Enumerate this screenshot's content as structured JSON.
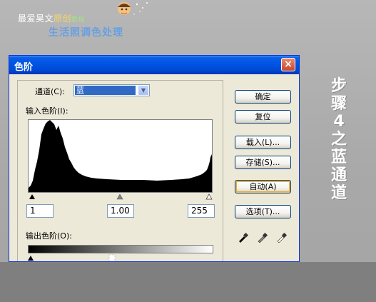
{
  "banner": {
    "title_prefix": "最爱昊文",
    "title_hl1": "原创",
    "title_suffix": "教程",
    "subtitle": "生活照调色处理"
  },
  "side_caption": [
    "步",
    "骤",
    "4",
    "之",
    "蓝",
    "通",
    "道"
  ],
  "dialog": {
    "title": "色阶",
    "close_label": "×",
    "channel_label": "通道(C):",
    "channel_value": "蓝",
    "input_levels_label": "输入色阶(I):",
    "input_values": [
      "1",
      "1.00",
      "255"
    ],
    "output_levels_label": "输出色阶(O):",
    "buttons": {
      "ok": "确定",
      "reset": "复位",
      "load": "载入(L)...",
      "save": "存储(S)...",
      "auto": "自动(A)",
      "options": "选项(T)..."
    },
    "eyedroppers": [
      "black-eyedropper-icon",
      "gray-eyedropper-icon",
      "white-eyedropper-icon"
    ]
  },
  "colors": {
    "titlebar": "#0054e3",
    "dialog_bg": "#ece9d8",
    "selection": "#316ac5"
  }
}
